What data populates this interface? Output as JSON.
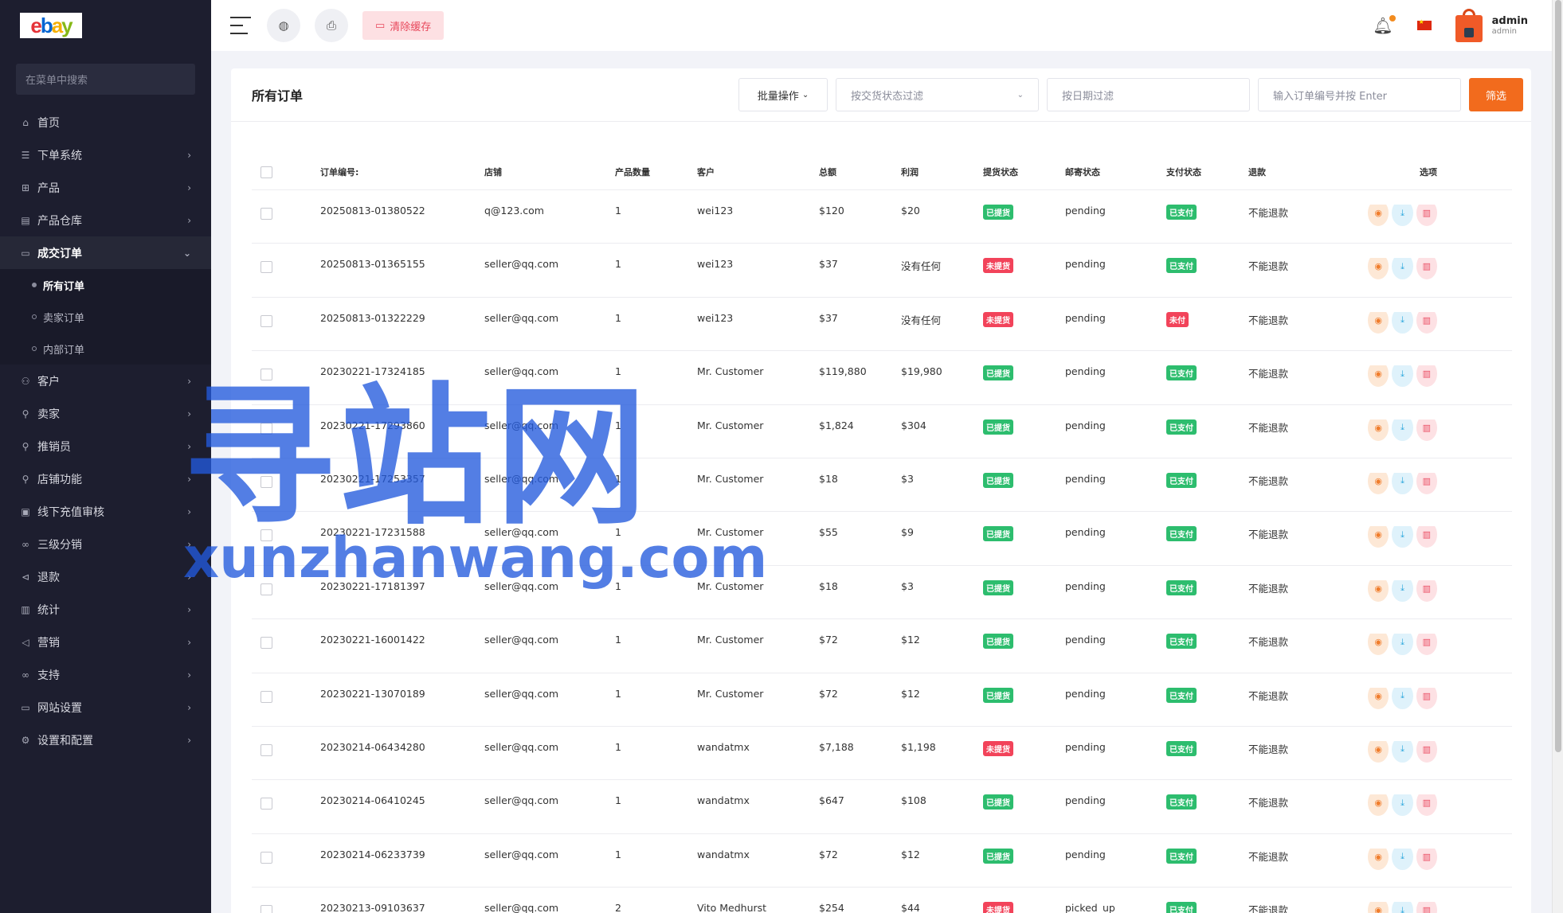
{
  "sidebar": {
    "logo": {
      "l1": "e",
      "l2": "b",
      "l3": "a",
      "l4": "y"
    },
    "search_placeholder": "在菜单中搜索",
    "items": [
      {
        "label": "首页",
        "icon": "home-icon",
        "glyph": "⌂"
      },
      {
        "label": "下单系统",
        "icon": "list-icon",
        "glyph": "☰"
      },
      {
        "label": "产品",
        "icon": "cart-icon",
        "glyph": "⊞"
      },
      {
        "label": "产品仓库",
        "icon": "warehouse-icon",
        "glyph": "▤"
      },
      {
        "label": "成交订单",
        "icon": "orders-icon",
        "glyph": "▭"
      },
      {
        "label": "客户",
        "icon": "users-icon",
        "glyph": "⚇"
      },
      {
        "label": "卖家",
        "icon": "seller-icon",
        "glyph": "⚲"
      },
      {
        "label": "推销员",
        "icon": "salesman-icon",
        "glyph": "⚲"
      },
      {
        "label": "店铺功能",
        "icon": "store-icon",
        "glyph": "⚲"
      },
      {
        "label": "线下充值审核",
        "icon": "recharge-icon",
        "glyph": "▣"
      },
      {
        "label": "三级分销",
        "icon": "link-icon",
        "glyph": "∞"
      },
      {
        "label": "退款",
        "icon": "refund-icon",
        "glyph": "⊲"
      },
      {
        "label": "统计",
        "icon": "stats-icon",
        "glyph": "▥"
      },
      {
        "label": "营销",
        "icon": "megaphone-icon",
        "glyph": "◁"
      },
      {
        "label": "支持",
        "icon": "support-icon",
        "glyph": "∞"
      },
      {
        "label": "网站设置",
        "icon": "monitor-icon",
        "glyph": "▭"
      },
      {
        "label": "设置和配置",
        "icon": "settings-icon",
        "glyph": "⚙"
      }
    ],
    "submenu": [
      "所有订单",
      "卖家订单",
      "内部订单"
    ]
  },
  "topbar": {
    "clear_cache": "清除缓存",
    "user_name": "admin",
    "user_role": "admin"
  },
  "card": {
    "title": "所有订单",
    "batch_label": "批量操作",
    "delivery_filter_placeholder": "按交货状态过滤",
    "date_filter_placeholder": "按日期过滤",
    "search_placeholder": "输入订单编号并按 Enter",
    "filter_button": "筛选"
  },
  "table": {
    "headers": {
      "id": "订单编号:",
      "shop": "店铺",
      "qty": "产品数量",
      "customer": "客户",
      "total": "总额",
      "profit": "利润",
      "pickup": "提货状态",
      "post": "邮寄状态",
      "pay": "支付状态",
      "refund": "退款",
      "options": "选项"
    },
    "rows": [
      {
        "id": "20250813-01380522",
        "shop": "q@123.com",
        "qty": "1",
        "customer": "wei123",
        "total": "$120",
        "profit": "$20",
        "pickup": "已提货",
        "pickup_color": "green",
        "post": "pending",
        "pay": "已支付",
        "pay_color": "green",
        "refund": "不能退款"
      },
      {
        "id": "20250813-01365155",
        "shop": "seller@qq.com",
        "qty": "1",
        "customer": "wei123",
        "total": "$37",
        "profit": "没有任何",
        "pickup": "未提货",
        "pickup_color": "red",
        "post": "pending",
        "pay": "已支付",
        "pay_color": "green",
        "refund": "不能退款"
      },
      {
        "id": "20250813-01322229",
        "shop": "seller@qq.com",
        "qty": "1",
        "customer": "wei123",
        "total": "$37",
        "profit": "没有任何",
        "pickup": "未提货",
        "pickup_color": "red",
        "post": "pending",
        "pay": "未付",
        "pay_color": "red",
        "refund": "不能退款"
      },
      {
        "id": "20230221-17324185",
        "shop": "seller@qq.com",
        "qty": "1",
        "customer": "Mr. Customer",
        "total": "$119,880",
        "profit": "$19,980",
        "pickup": "已提货",
        "pickup_color": "green",
        "post": "pending",
        "pay": "已支付",
        "pay_color": "green",
        "refund": "不能退款"
      },
      {
        "id": "20230221-17293860",
        "shop": "seller@qq.com",
        "qty": "1",
        "customer": "Mr. Customer",
        "total": "$1,824",
        "profit": "$304",
        "pickup": "已提货",
        "pickup_color": "green",
        "post": "pending",
        "pay": "已支付",
        "pay_color": "green",
        "refund": "不能退款"
      },
      {
        "id": "20230221-17253357",
        "shop": "seller@qq.com",
        "qty": "1",
        "customer": "Mr. Customer",
        "total": "$18",
        "profit": "$3",
        "pickup": "已提货",
        "pickup_color": "green",
        "post": "pending",
        "pay": "已支付",
        "pay_color": "green",
        "refund": "不能退款"
      },
      {
        "id": "20230221-17231588",
        "shop": "seller@qq.com",
        "qty": "1",
        "customer": "Mr. Customer",
        "total": "$55",
        "profit": "$9",
        "pickup": "已提货",
        "pickup_color": "green",
        "post": "pending",
        "pay": "已支付",
        "pay_color": "green",
        "refund": "不能退款"
      },
      {
        "id": "20230221-17181397",
        "shop": "seller@qq.com",
        "qty": "1",
        "customer": "Mr. Customer",
        "total": "$18",
        "profit": "$3",
        "pickup": "已提货",
        "pickup_color": "green",
        "post": "pending",
        "pay": "已支付",
        "pay_color": "green",
        "refund": "不能退款"
      },
      {
        "id": "20230221-16001422",
        "shop": "seller@qq.com",
        "qty": "1",
        "customer": "Mr. Customer",
        "total": "$72",
        "profit": "$12",
        "pickup": "已提货",
        "pickup_color": "green",
        "post": "pending",
        "pay": "已支付",
        "pay_color": "green",
        "refund": "不能退款"
      },
      {
        "id": "20230221-13070189",
        "shop": "seller@qq.com",
        "qty": "1",
        "customer": "Mr. Customer",
        "total": "$72",
        "profit": "$12",
        "pickup": "已提货",
        "pickup_color": "green",
        "post": "pending",
        "pay": "已支付",
        "pay_color": "green",
        "refund": "不能退款"
      },
      {
        "id": "20230214-06434280",
        "shop": "seller@qq.com",
        "qty": "1",
        "customer": "wandatmx",
        "total": "$7,188",
        "profit": "$1,198",
        "pickup": "未提货",
        "pickup_color": "red",
        "post": "pending",
        "pay": "已支付",
        "pay_color": "green",
        "refund": "不能退款"
      },
      {
        "id": "20230214-06410245",
        "shop": "seller@qq.com",
        "qty": "1",
        "customer": "wandatmx",
        "total": "$647",
        "profit": "$108",
        "pickup": "已提货",
        "pickup_color": "green",
        "post": "pending",
        "pay": "已支付",
        "pay_color": "green",
        "refund": "不能退款"
      },
      {
        "id": "20230214-06233739",
        "shop": "seller@qq.com",
        "qty": "1",
        "customer": "wandatmx",
        "total": "$72",
        "profit": "$12",
        "pickup": "已提货",
        "pickup_color": "green",
        "post": "pending",
        "pay": "已支付",
        "pay_color": "green",
        "refund": "不能退款"
      },
      {
        "id": "20230213-09103637",
        "shop": "seller@qq.com",
        "qty": "2",
        "customer": "Vito Medhurst",
        "total": "$254",
        "profit": "$44",
        "pickup": "未提货",
        "pickup_color": "red",
        "post": "picked_up",
        "pay": "已支付",
        "pay_color": "green",
        "refund": "不能退款"
      }
    ]
  },
  "watermark": {
    "big": "寻站网",
    "small": "xunzhanwang.com"
  },
  "colors": {
    "sidebar_bg": "#1d1e2f",
    "accent_orange": "#f26b1d",
    "tag_green": "#2dbd6e",
    "tag_red": "#f2435a"
  }
}
